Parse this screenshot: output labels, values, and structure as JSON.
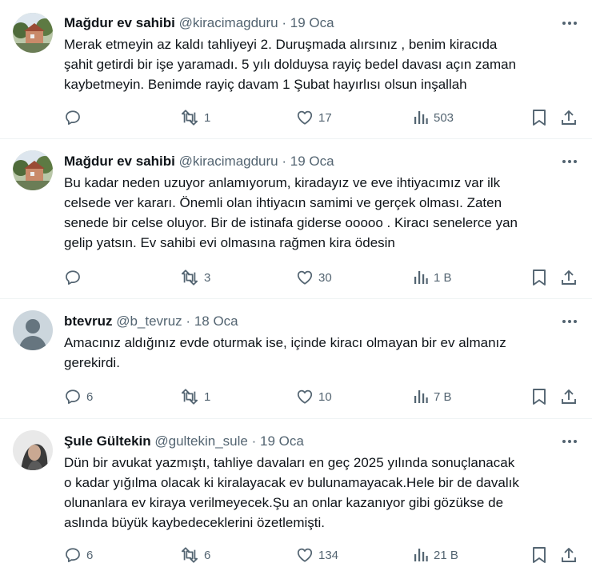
{
  "tweets": [
    {
      "name": "Mağdur ev sahibi",
      "handle": "@kiracimagduru",
      "sep": "·",
      "date": "19 Oca",
      "avatar": "house-photo",
      "lines": [
        "Merak etmeyin az kaldı tahliyeyi 2. Duruşmada alırsınız , benim kiracıda",
        "şahit getirdi bir işe yaramadı. 5 yılı dolduysa rayiç bedel davası açın zaman",
        "kaybetmeyin. Benimde rayiç davam 1 Şubat hayırlısı olsun inşallah"
      ],
      "replies": "",
      "retweets": "1",
      "likes": "17",
      "views": "503"
    },
    {
      "name": "Mağdur ev sahibi",
      "handle": "@kiracimagduru",
      "sep": "·",
      "date": "19 Oca",
      "avatar": "house-photo",
      "lines": [
        "Bu kadar neden uzuyor anlamıyorum, kiradayız ve eve ihtiyacımız var ilk",
        "celsede ver kararı. Önemli olan ihtiyacın samimi ve gerçek olması. Zaten",
        "senede bir celse oluyor. Bir de istinafa giderse ooooo . Kiracı senelerce yan",
        "gelip yatsın. Ev sahibi evi olmasına rağmen kira ödesin"
      ],
      "replies": "",
      "retweets": "3",
      "likes": "30",
      "views": "1 B"
    },
    {
      "name": "btevruz",
      "handle": "@b_tevruz",
      "sep": "·",
      "date": "18 Oca",
      "avatar": "default-person",
      "lines": [
        "Amacınız aldığınız evde oturmak ise, içinde kiracı olmayan bir ev almanız",
        "gerekirdi."
      ],
      "replies": "6",
      "retweets": "1",
      "likes": "10",
      "views": "7 B"
    },
    {
      "name": "Şule Gültekin",
      "handle": "@gultekin_sule",
      "sep": "·",
      "date": "19 Oca",
      "avatar": "woman-photo",
      "lines": [
        "Dün bir avukat yazmıştı, tahliye davaları en geç 2025 yılında sonuçlanacak",
        "o kadar yığılma olacak ki kiralayacak ev bulunamayacak.Hele bir de davalık",
        "olunanlara ev kiraya verilmeyecek.Şu an onlar kazanıyor gibi gözükse de",
        "aslında büyük kaybedeceklerini özetlemişti."
      ],
      "replies": "6",
      "retweets": "6",
      "likes": "134",
      "views": "21 B"
    }
  ],
  "icons": {
    "reply": "reply-icon",
    "retweet": "retweet-icon",
    "like": "heart-icon",
    "views": "views-icon",
    "bookmark": "bookmark-icon",
    "share": "share-icon",
    "more": "more-icon"
  },
  "colors": {
    "text": "#0f1419",
    "secondary": "#536471",
    "divider": "#eff3f4"
  }
}
